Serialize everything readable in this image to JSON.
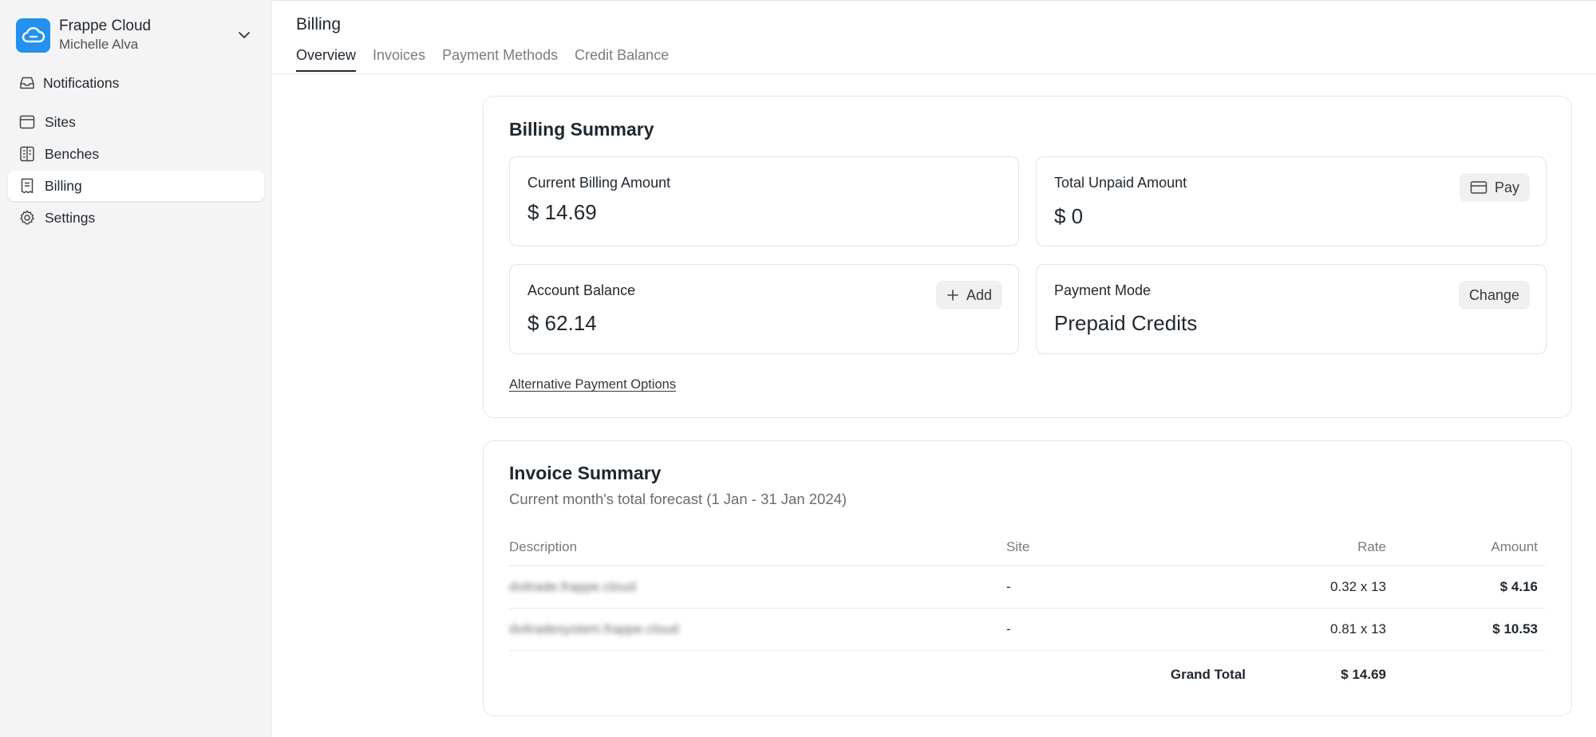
{
  "org": {
    "name": "Frappe Cloud",
    "user": "Michelle Alva"
  },
  "nav": {
    "notifications": "Notifications",
    "items": [
      {
        "label": "Sites",
        "icon": "browser-window-icon"
      },
      {
        "label": "Benches",
        "icon": "bench-icon"
      },
      {
        "label": "Billing",
        "icon": "receipt-icon",
        "active": true
      },
      {
        "label": "Settings",
        "icon": "gear-icon"
      }
    ]
  },
  "header": {
    "title": "Billing",
    "tabs": [
      "Overview",
      "Invoices",
      "Payment Methods",
      "Credit Balance"
    ]
  },
  "billing_summary": {
    "title": "Billing Summary",
    "current_billing_label": "Current Billing Amount",
    "current_billing_value": "$ 14.69",
    "total_unpaid_label": "Total Unpaid Amount",
    "total_unpaid_value": "$ 0",
    "pay_button": "Pay",
    "account_balance_label": "Account Balance",
    "account_balance_value": "$ 62.14",
    "add_button": "Add",
    "payment_mode_label": "Payment Mode",
    "payment_mode_value": "Prepaid Credits",
    "change_button": "Change",
    "alt_payment_link": "Alternative Payment Options"
  },
  "invoice_summary": {
    "title": "Invoice Summary",
    "subtitle": "Current month's total forecast (1 Jan - 31 Jan 2024)",
    "columns": {
      "description": "Description",
      "site": "Site",
      "rate": "Rate",
      "amount": "Amount"
    },
    "rows": [
      {
        "description": "dvitrade.frappe.cloud",
        "site": "-",
        "rate": "0.32 x 13",
        "amount": "$ 4.16"
      },
      {
        "description": "dvitradesystem.frappe.cloud",
        "site": "-",
        "rate": "0.81 x 13",
        "amount": "$ 10.53"
      }
    ],
    "grand_total_label": "Grand Total",
    "grand_total_value": "$ 14.69"
  },
  "colors": {
    "brand": "#2490ef",
    "sidebar_bg": "#f4f4f5",
    "text": "#1f272e"
  }
}
